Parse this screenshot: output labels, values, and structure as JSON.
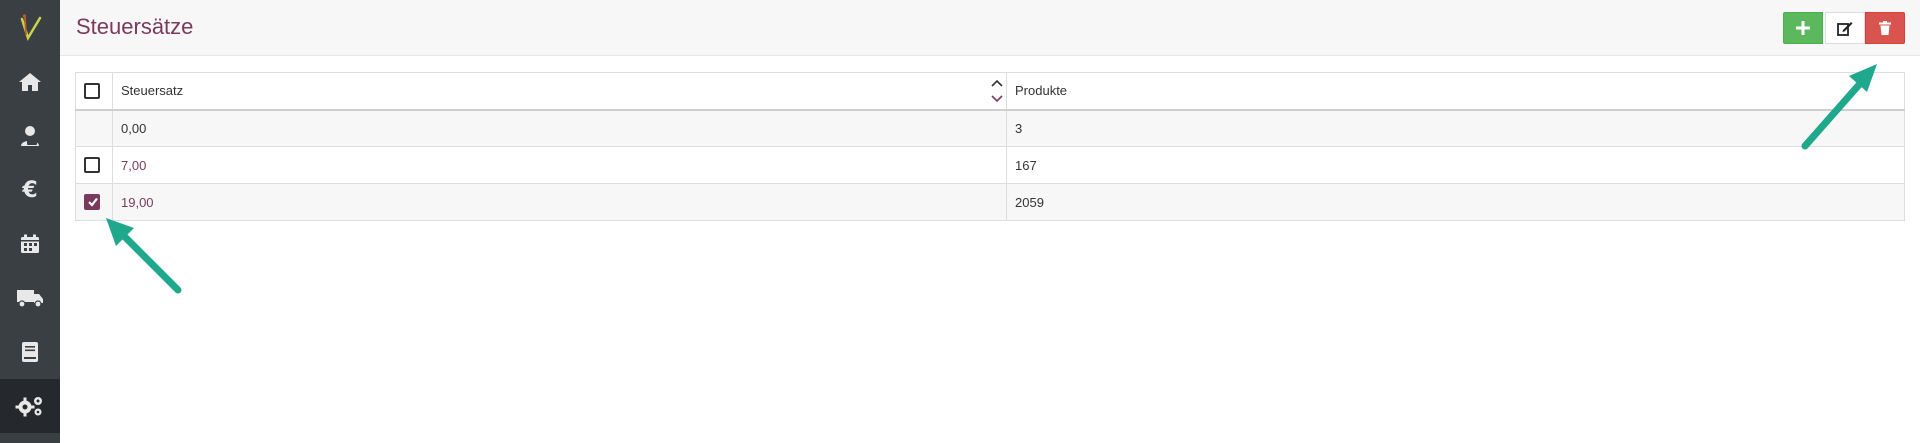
{
  "page": {
    "title": "Steuersätze"
  },
  "colors": {
    "accent": "#7a3a5c",
    "sidebar": "#3a3f44",
    "add": "#5cb85c",
    "delete": "#d9534f",
    "arrow": "#1fa88b"
  },
  "sidebar": {
    "items": [
      {
        "icon": "home-icon"
      },
      {
        "icon": "customer-icon"
      },
      {
        "icon": "euro-icon"
      },
      {
        "icon": "calendar-icon"
      },
      {
        "icon": "truck-icon"
      },
      {
        "icon": "book-icon"
      },
      {
        "icon": "gears-icon",
        "active": true
      }
    ]
  },
  "toolbar": {
    "add": "add-icon",
    "edit": "edit-icon",
    "delete": "trash-icon"
  },
  "table": {
    "headers": {
      "rate": "Steuersatz",
      "products": "Produkte"
    },
    "rows": [
      {
        "rate": "0,00",
        "products": "3",
        "checkbox": false,
        "checked": false
      },
      {
        "rate": "7,00",
        "products": "167",
        "checkbox": true,
        "checked": false
      },
      {
        "rate": "19,00",
        "products": "2059",
        "checkbox": true,
        "checked": true
      }
    ]
  }
}
